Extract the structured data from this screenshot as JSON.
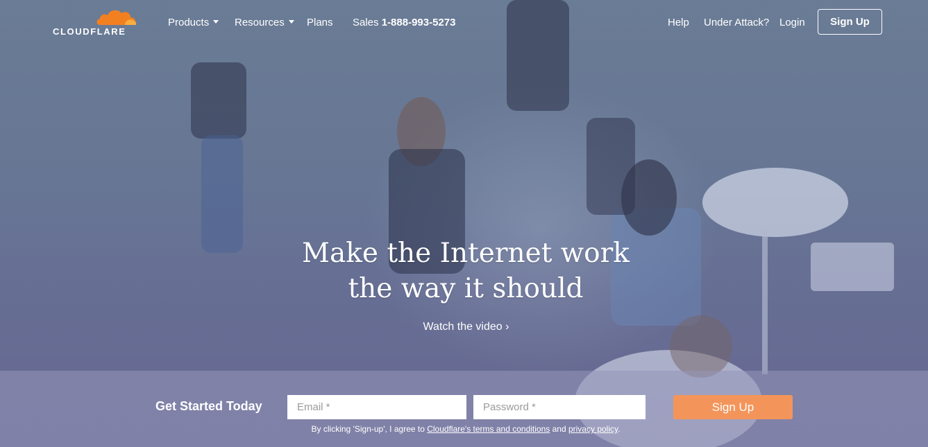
{
  "brand": {
    "name": "CLOUDFLARE",
    "accent_color": "#f38020",
    "logo_icon": "cloud-icon"
  },
  "nav": {
    "left": [
      {
        "label": "Products",
        "has_dropdown": true
      },
      {
        "label": "Resources",
        "has_dropdown": true
      },
      {
        "label": "Plans",
        "has_dropdown": false
      }
    ],
    "sales_label": "Sales",
    "sales_phone": "1-888-993-5273",
    "right": [
      {
        "label": "Help"
      },
      {
        "label": "Under Attack?"
      },
      {
        "label": "Login"
      }
    ],
    "signup_label": "Sign Up"
  },
  "hero": {
    "headline_line1": "Make the Internet work",
    "headline_line2": "the way it should",
    "watch_video": "Watch the video ›"
  },
  "signup_bar": {
    "title": "Get Started Today",
    "email_placeholder": "Email *",
    "password_placeholder": "Password *",
    "button_label": "Sign Up",
    "button_color": "#f3955a",
    "legal_prefix": "By clicking 'Sign-up', I agree to ",
    "terms_link": "Cloudflare's terms and conditions",
    "legal_and": " and ",
    "privacy_link": "privacy policy",
    "legal_suffix": "."
  }
}
